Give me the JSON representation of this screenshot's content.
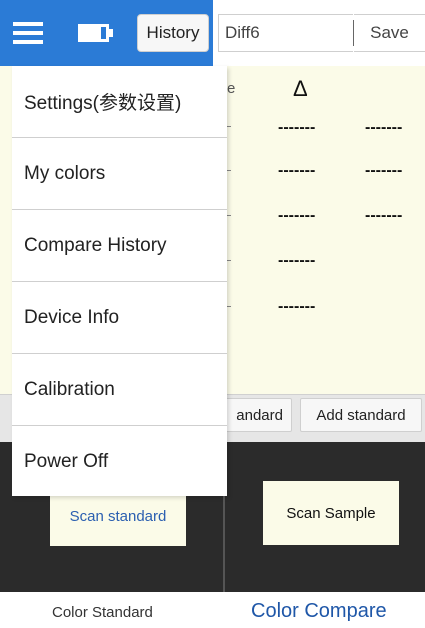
{
  "toolbar": {
    "history_label": "History",
    "name_value": "Diff6",
    "save_label": "Save"
  },
  "compare": {
    "delta_symbol": "Δ",
    "peek_text": "e",
    "dash": "-------"
  },
  "buttons": {
    "standard_partial": "andard",
    "add_standard": "Add standard"
  },
  "scan": {
    "scan_standard": "Scan standard",
    "scan_sample": "Scan Sample"
  },
  "bottom_nav": {
    "color_standard": "Color Standard",
    "color_compare": "Color Compare"
  },
  "drawer": {
    "items": [
      {
        "label": "Settings(参数设置)"
      },
      {
        "label": "My colors"
      },
      {
        "label": "Compare History"
      },
      {
        "label": "Device Info"
      },
      {
        "label": "Calibration"
      },
      {
        "label": "Power Off"
      }
    ]
  },
  "colors": {
    "accent_blue": "#2b7bd6",
    "panel_cream": "#fbfbe8",
    "dark_bg": "#2b2b2b",
    "active_nav": "#1f57a8"
  },
  "icons": {
    "menu": "hamburger-icon",
    "battery": "battery-icon"
  }
}
